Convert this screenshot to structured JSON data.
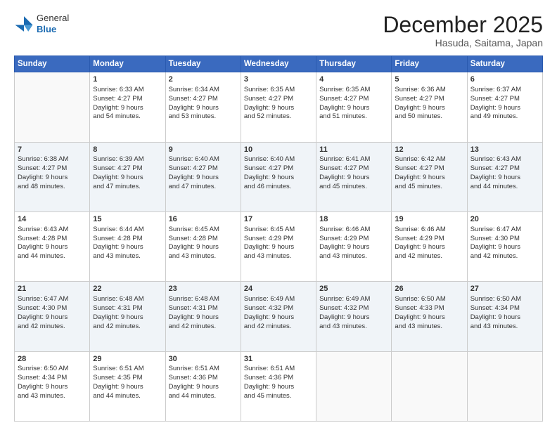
{
  "header": {
    "logo": {
      "general": "General",
      "blue": "Blue"
    },
    "title": "December 2025",
    "location": "Hasuda, Saitama, Japan"
  },
  "days_of_week": [
    "Sunday",
    "Monday",
    "Tuesday",
    "Wednesday",
    "Thursday",
    "Friday",
    "Saturday"
  ],
  "weeks": [
    [
      {
        "day": "",
        "info": ""
      },
      {
        "day": "1",
        "info": "Sunrise: 6:33 AM\nSunset: 4:27 PM\nDaylight: 9 hours\nand 54 minutes."
      },
      {
        "day": "2",
        "info": "Sunrise: 6:34 AM\nSunset: 4:27 PM\nDaylight: 9 hours\nand 53 minutes."
      },
      {
        "day": "3",
        "info": "Sunrise: 6:35 AM\nSunset: 4:27 PM\nDaylight: 9 hours\nand 52 minutes."
      },
      {
        "day": "4",
        "info": "Sunrise: 6:35 AM\nSunset: 4:27 PM\nDaylight: 9 hours\nand 51 minutes."
      },
      {
        "day": "5",
        "info": "Sunrise: 6:36 AM\nSunset: 4:27 PM\nDaylight: 9 hours\nand 50 minutes."
      },
      {
        "day": "6",
        "info": "Sunrise: 6:37 AM\nSunset: 4:27 PM\nDaylight: 9 hours\nand 49 minutes."
      }
    ],
    [
      {
        "day": "7",
        "info": "Sunrise: 6:38 AM\nSunset: 4:27 PM\nDaylight: 9 hours\nand 48 minutes."
      },
      {
        "day": "8",
        "info": "Sunrise: 6:39 AM\nSunset: 4:27 PM\nDaylight: 9 hours\nand 47 minutes."
      },
      {
        "day": "9",
        "info": "Sunrise: 6:40 AM\nSunset: 4:27 PM\nDaylight: 9 hours\nand 47 minutes."
      },
      {
        "day": "10",
        "info": "Sunrise: 6:40 AM\nSunset: 4:27 PM\nDaylight: 9 hours\nand 46 minutes."
      },
      {
        "day": "11",
        "info": "Sunrise: 6:41 AM\nSunset: 4:27 PM\nDaylight: 9 hours\nand 45 minutes."
      },
      {
        "day": "12",
        "info": "Sunrise: 6:42 AM\nSunset: 4:27 PM\nDaylight: 9 hours\nand 45 minutes."
      },
      {
        "day": "13",
        "info": "Sunrise: 6:43 AM\nSunset: 4:27 PM\nDaylight: 9 hours\nand 44 minutes."
      }
    ],
    [
      {
        "day": "14",
        "info": "Sunrise: 6:43 AM\nSunset: 4:28 PM\nDaylight: 9 hours\nand 44 minutes."
      },
      {
        "day": "15",
        "info": "Sunrise: 6:44 AM\nSunset: 4:28 PM\nDaylight: 9 hours\nand 43 minutes."
      },
      {
        "day": "16",
        "info": "Sunrise: 6:45 AM\nSunset: 4:28 PM\nDaylight: 9 hours\nand 43 minutes."
      },
      {
        "day": "17",
        "info": "Sunrise: 6:45 AM\nSunset: 4:29 PM\nDaylight: 9 hours\nand 43 minutes."
      },
      {
        "day": "18",
        "info": "Sunrise: 6:46 AM\nSunset: 4:29 PM\nDaylight: 9 hours\nand 43 minutes."
      },
      {
        "day": "19",
        "info": "Sunrise: 6:46 AM\nSunset: 4:29 PM\nDaylight: 9 hours\nand 42 minutes."
      },
      {
        "day": "20",
        "info": "Sunrise: 6:47 AM\nSunset: 4:30 PM\nDaylight: 9 hours\nand 42 minutes."
      }
    ],
    [
      {
        "day": "21",
        "info": "Sunrise: 6:47 AM\nSunset: 4:30 PM\nDaylight: 9 hours\nand 42 minutes."
      },
      {
        "day": "22",
        "info": "Sunrise: 6:48 AM\nSunset: 4:31 PM\nDaylight: 9 hours\nand 42 minutes."
      },
      {
        "day": "23",
        "info": "Sunrise: 6:48 AM\nSunset: 4:31 PM\nDaylight: 9 hours\nand 42 minutes."
      },
      {
        "day": "24",
        "info": "Sunrise: 6:49 AM\nSunset: 4:32 PM\nDaylight: 9 hours\nand 42 minutes."
      },
      {
        "day": "25",
        "info": "Sunrise: 6:49 AM\nSunset: 4:32 PM\nDaylight: 9 hours\nand 43 minutes."
      },
      {
        "day": "26",
        "info": "Sunrise: 6:50 AM\nSunset: 4:33 PM\nDaylight: 9 hours\nand 43 minutes."
      },
      {
        "day": "27",
        "info": "Sunrise: 6:50 AM\nSunset: 4:34 PM\nDaylight: 9 hours\nand 43 minutes."
      }
    ],
    [
      {
        "day": "28",
        "info": "Sunrise: 6:50 AM\nSunset: 4:34 PM\nDaylight: 9 hours\nand 43 minutes."
      },
      {
        "day": "29",
        "info": "Sunrise: 6:51 AM\nSunset: 4:35 PM\nDaylight: 9 hours\nand 44 minutes."
      },
      {
        "day": "30",
        "info": "Sunrise: 6:51 AM\nSunset: 4:36 PM\nDaylight: 9 hours\nand 44 minutes."
      },
      {
        "day": "31",
        "info": "Sunrise: 6:51 AM\nSunset: 4:36 PM\nDaylight: 9 hours\nand 45 minutes."
      },
      {
        "day": "",
        "info": ""
      },
      {
        "day": "",
        "info": ""
      },
      {
        "day": "",
        "info": ""
      }
    ]
  ]
}
